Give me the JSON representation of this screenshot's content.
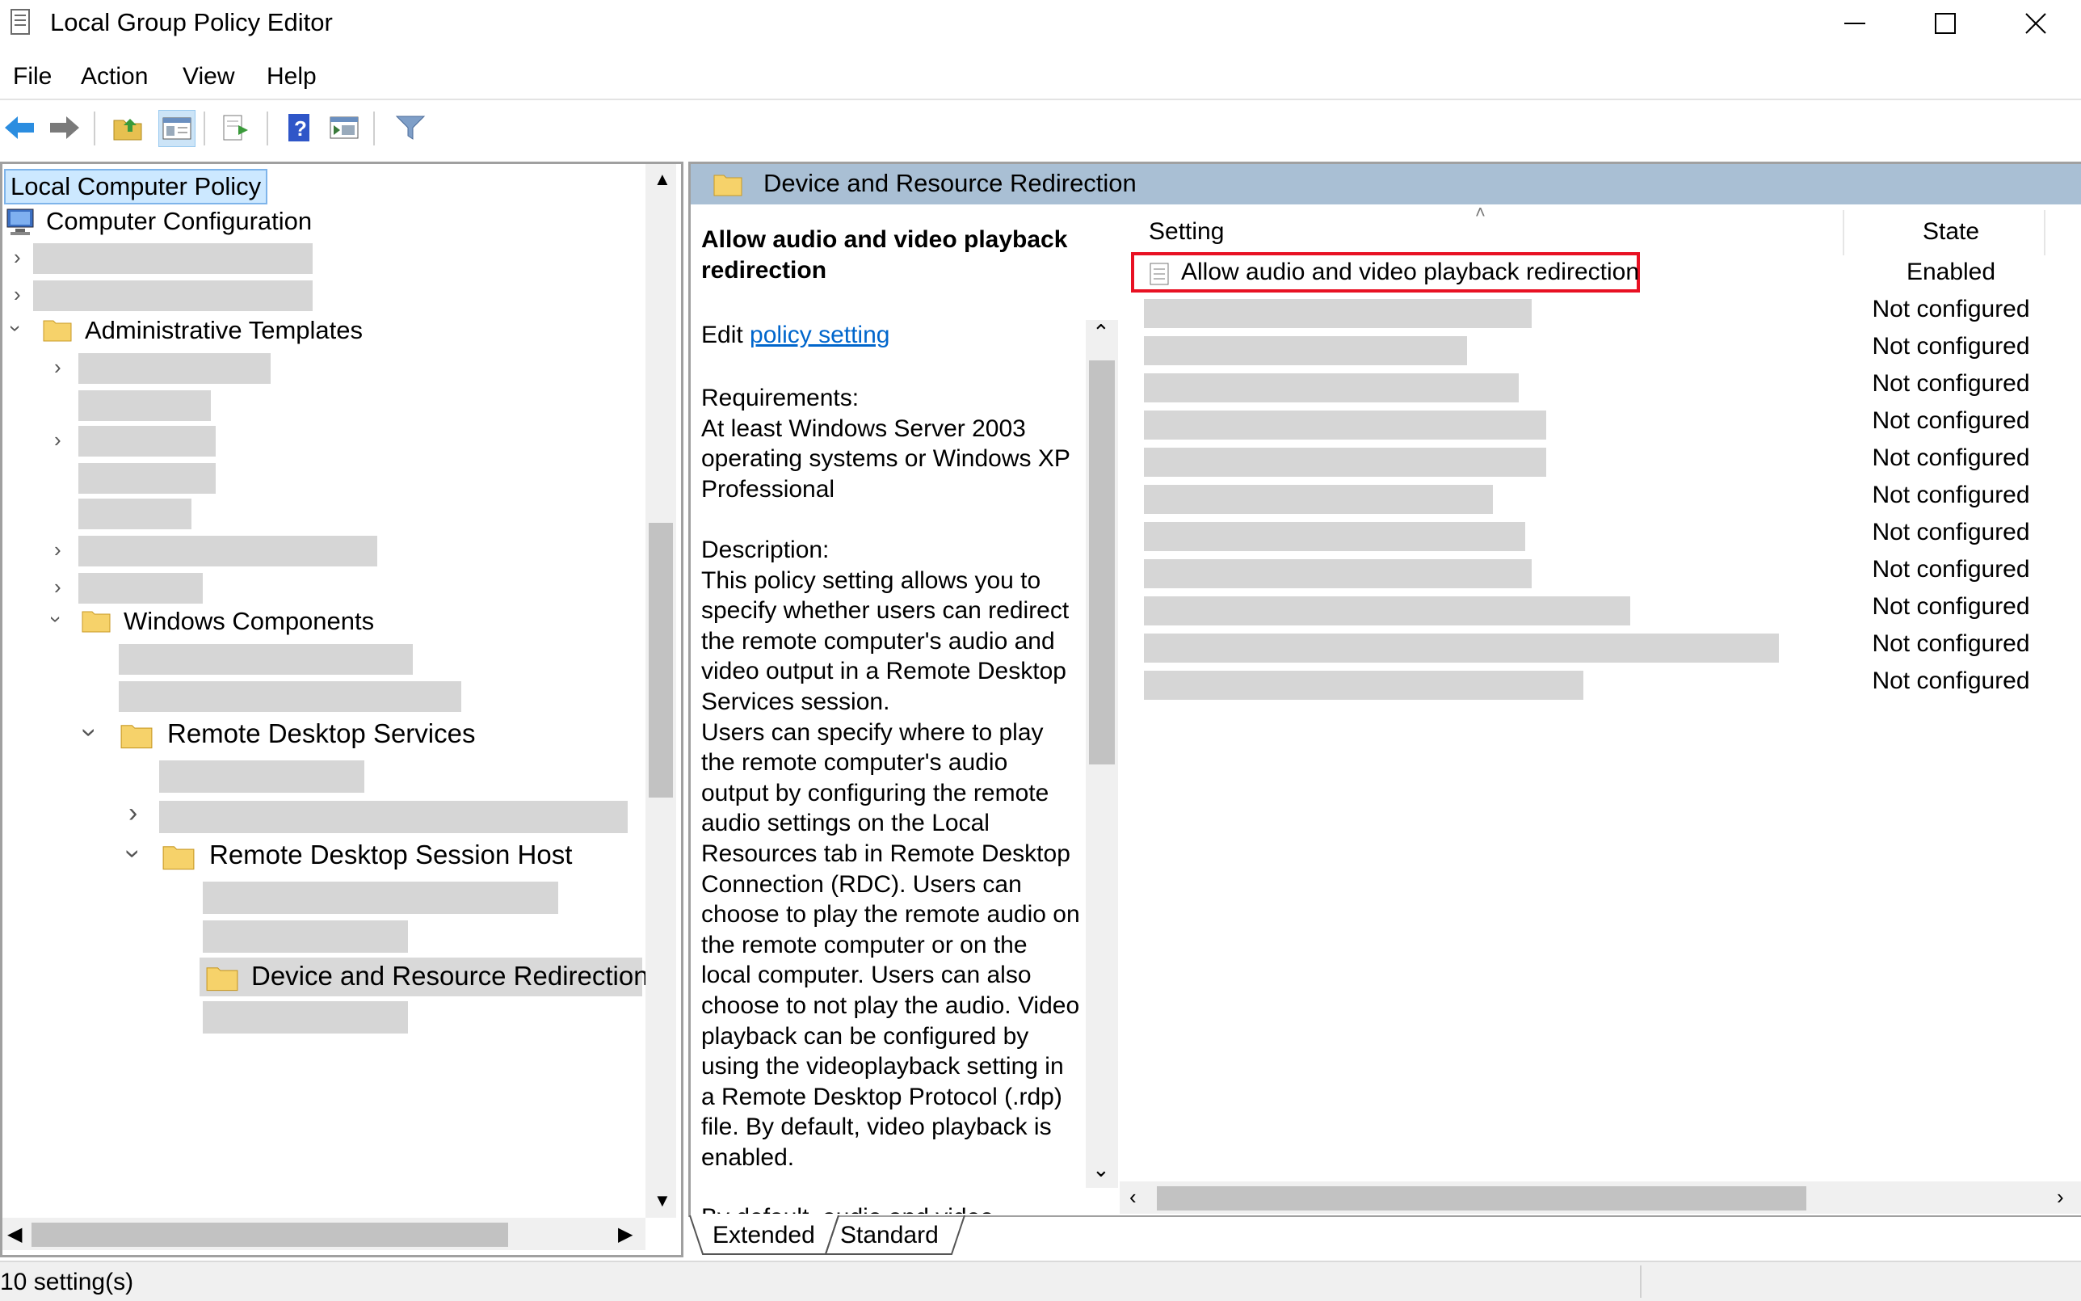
{
  "window": {
    "title": "Local Group Policy Editor",
    "controls": {
      "minimize": "—",
      "maximize": "☐",
      "close": "✕"
    }
  },
  "menu": [
    "File",
    "Action",
    "View",
    "Help"
  ],
  "toolbar": {
    "icons": [
      "back-arrow-icon",
      "forward-arrow-icon",
      "up-folder-icon",
      "show-hide-tree-icon",
      "export-list-icon",
      "help-icon",
      "properties-icon",
      "filter-icon"
    ]
  },
  "tree": {
    "root": "Local Computer Policy",
    "computer_configuration": "Computer Configuration",
    "administrative_templates": "Administrative Templates",
    "windows_components": "Windows Components",
    "remote_desktop_services": "Remote Desktop Services",
    "rd_session_host": "Remote Desktop Session Host",
    "device_redirection": "Device and Resource Redirection"
  },
  "details": {
    "header": "Device and Resource Redirection",
    "policy_title": "Allow audio and video playback redirection",
    "edit_prefix": "Edit",
    "edit_link": "policy setting",
    "requirements_label": "Requirements:",
    "requirements_text": "At least Windows Server 2003 operating systems or Windows XP Professional",
    "description_label": "Description:",
    "description_p1": "This policy setting allows you to specify whether users can redirect the remote computer's audio and video output in a Remote Desktop Services session.",
    "description_p2": "Users can specify where to play the remote computer's audio output by configuring the remote audio settings on the Local Resources tab in Remote Desktop Connection (RDC). Users can choose to play the remote audio on the remote computer or on the local computer. Users can also choose to not play the audio. Video playback can be configured by using the videoplayback setting in a Remote Desktop Protocol (.rdp) file. By default, video playback is enabled.",
    "description_p3": "By default, audio and video"
  },
  "list": {
    "col_setting": "Setting",
    "col_state": "State",
    "highlighted_setting": "Allow audio and video playback redirection",
    "states": [
      "Enabled",
      "Not configured",
      "Not configured",
      "Not configured",
      "Not configured",
      "Not configured",
      "Not configured",
      "Not configured",
      "Not configured",
      "Not configured",
      "Not configured",
      "Not configured"
    ]
  },
  "tabs": [
    "Extended",
    "Standard"
  ],
  "status": {
    "text": "10 setting(s)"
  },
  "colors": {
    "highlight_border": "#e81123",
    "link": "#0066cc",
    "header_blue": "#a9bfd4"
  }
}
